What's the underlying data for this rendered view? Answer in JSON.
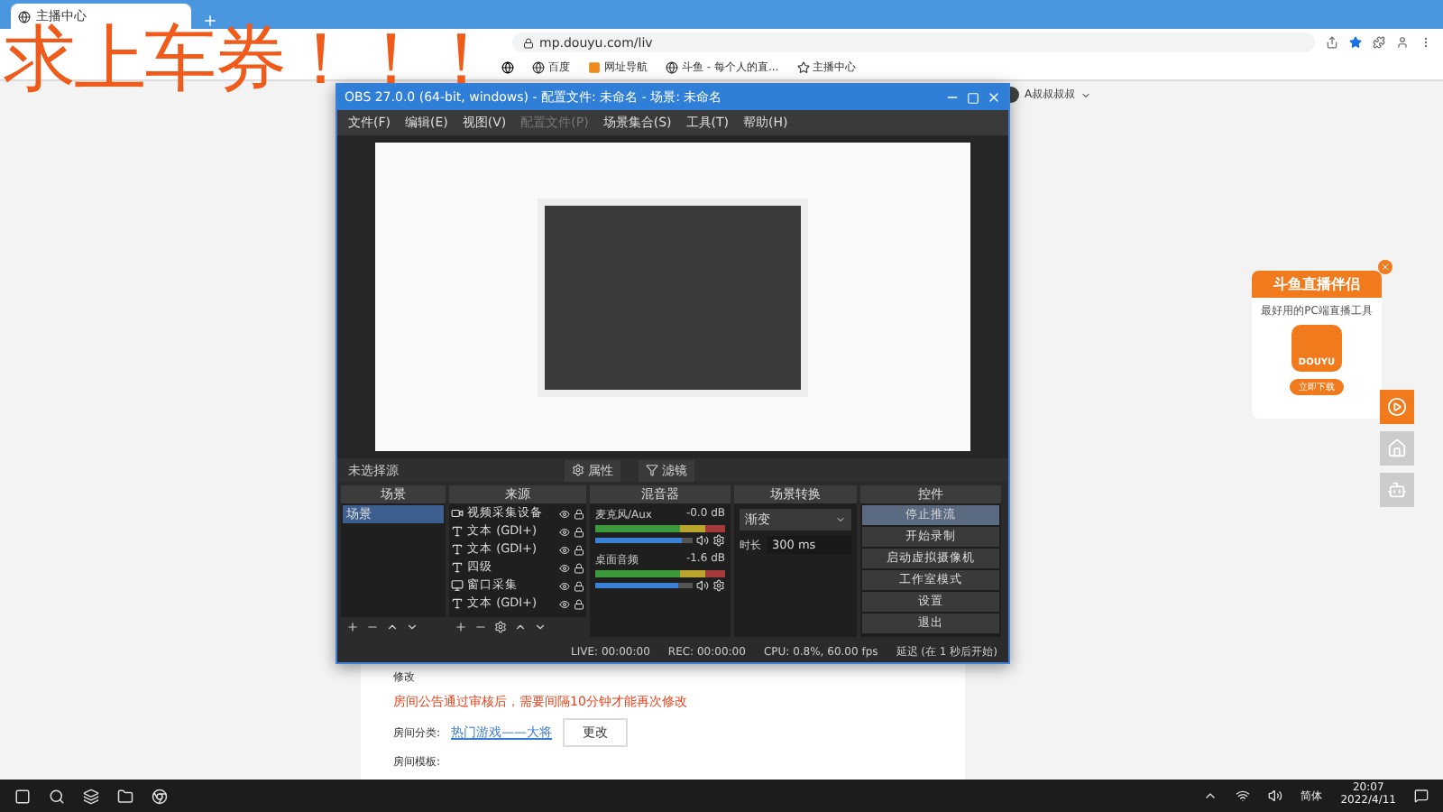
{
  "browser": {
    "tab": {
      "title": "主播中心"
    },
    "address": "mp.douyu.com/liv",
    "bookmarks": [
      {
        "label": "百度",
        "kind": "globe"
      },
      {
        "label": "网址导航",
        "kind": "orange"
      },
      {
        "label": "斗鱼 - 每个人的直...",
        "kind": "globe"
      },
      {
        "label": "主播中心",
        "kind": "fish"
      }
    ]
  },
  "overlay_text": "求上车券！！！",
  "obs": {
    "title": "OBS 27.0.0 (64-bit, windows) - 配置文件: 未命名 - 场景: 未命名",
    "menu": [
      {
        "label": "文件(F)",
        "disabled": false
      },
      {
        "label": "编辑(E)",
        "disabled": false
      },
      {
        "label": "视图(V)",
        "disabled": false
      },
      {
        "label": "配置文件(P)",
        "disabled": true
      },
      {
        "label": "场景集合(S)",
        "disabled": false
      },
      {
        "label": "工具(T)",
        "disabled": false
      },
      {
        "label": "帮助(H)",
        "disabled": false
      }
    ],
    "source_status": "未选择源",
    "source_buttons": [
      "属性",
      "滤镜"
    ],
    "scenes": {
      "header": "场景",
      "items": [
        {
          "label": "场景",
          "selected": true
        }
      ]
    },
    "sources": {
      "header": "来源",
      "items": [
        {
          "label": "视频采集设备",
          "kind": "video"
        },
        {
          "label": "文本 (GDI+)",
          "kind": "text"
        },
        {
          "label": "文本 (GDI+)",
          "kind": "text"
        },
        {
          "label": "四级",
          "kind": "text"
        },
        {
          "label": "窗口采集",
          "kind": "window"
        },
        {
          "label": "文本 (GDI+)",
          "kind": "text"
        }
      ]
    },
    "mixer": {
      "header": "混音器",
      "channels": [
        {
          "name": "麦克风/Aux",
          "reading": "-0.0 dB",
          "level": 0.88
        },
        {
          "name": "桌面音频",
          "reading": "-1.6 dB",
          "level": 0.85
        }
      ]
    },
    "transitions": {
      "header": "场景转换",
      "value": "渐变",
      "duration_label": "时长",
      "duration": "300 ms"
    },
    "controls": {
      "header": "控件",
      "buttons": [
        {
          "label": "停止推流",
          "active": true
        },
        {
          "label": "开始录制",
          "active": false
        },
        {
          "label": "启动虚拟摄像机",
          "active": false
        },
        {
          "label": "工作室模式",
          "active": false
        },
        {
          "label": "设置",
          "active": false
        },
        {
          "label": "退出",
          "active": false
        }
      ]
    },
    "status": [
      "LIVE: 00:00:00",
      "REC: 00:00:00",
      "CPU: 0.8%, 60.00 fps",
      "延迟 (在 1 秒后开始)"
    ]
  },
  "page": {
    "user": "A叔叔叔叔",
    "edit_link": "修改",
    "notice": "房间公告通过审核后，需要间隔10分钟才能再次修改",
    "category_label": "房间分类:",
    "category_value": "热门游戏——大将",
    "change_button": "更改",
    "template_label": "房间模板:"
  },
  "ad": {
    "title": "斗鱼直播伴侣",
    "subtitle": "最好用的PC端直播工具",
    "logo": "DOUYU",
    "button": "立即下载"
  },
  "taskbar": {
    "ime": "简体",
    "time": "20:07",
    "date": "2022/4/11"
  }
}
